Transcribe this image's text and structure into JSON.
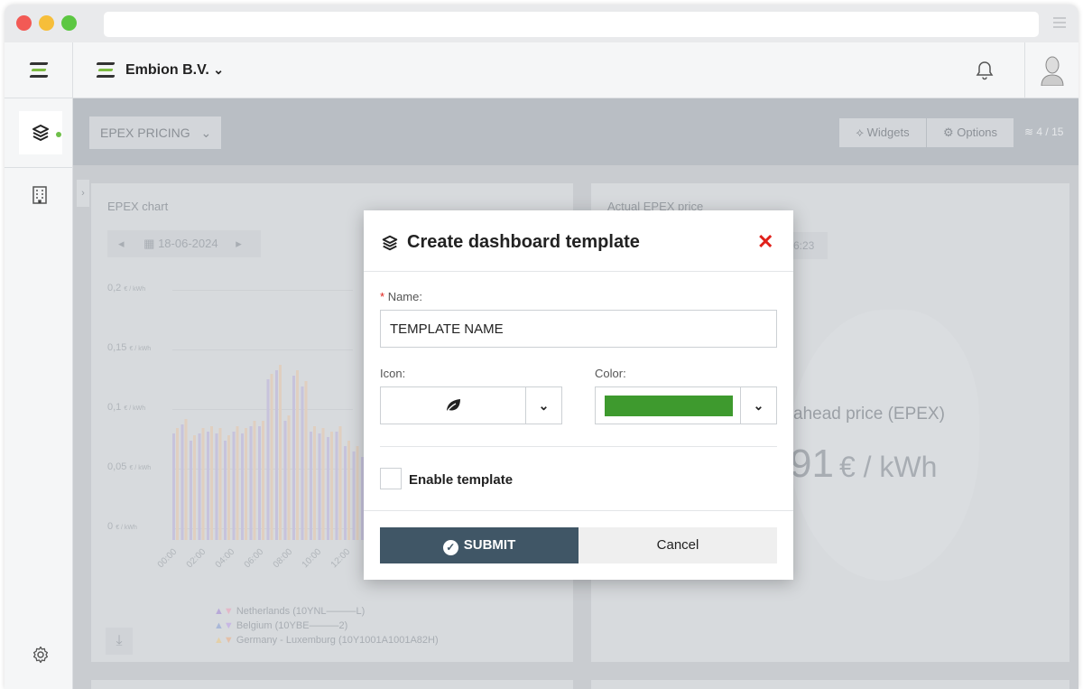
{
  "app": {
    "company": "Embion B.V.",
    "company_chevron": "⌄"
  },
  "toolbar": {
    "dashboard_select": "EPEX PRICING",
    "widgets_label": "Widgets",
    "options_label": "Options",
    "dashboard_count": "4 / 15"
  },
  "epex_chart_card": {
    "title": "EPEX chart",
    "date": "18-06-2024",
    "y_ticks": [
      "0,2",
      "0,15",
      "0,1",
      "0,05",
      "0"
    ],
    "y_unit": "€ / kWh",
    "x_ticks": [
      "00:00",
      "02:00",
      "04:00",
      "06:00",
      "08:00",
      "10:00",
      "12:00"
    ],
    "legend": [
      "Netherlands (10YNL———L)",
      "Belgium (10YBE———2)",
      "Germany - Luxemburg (10Y1001A1001A82H)"
    ]
  },
  "actual_price_card": {
    "title": "Actual EPEX price",
    "time_partial": "6:23",
    "label_partial": "ahead price (EPEX)",
    "value_partial": "91",
    "unit": "€ / kWh"
  },
  "modal": {
    "title": "Create dashboard template",
    "close_icon": "✕",
    "name_label": "Name:",
    "required_mark": "*",
    "name_value": "TEMPLATE NAME",
    "icon_label": "Icon:",
    "selected_icon": "leaf-icon",
    "color_label": "Color:",
    "selected_color": "#3e9a2e",
    "enable_label": "Enable template",
    "enable_checked": false,
    "submit_label": "SUBMIT",
    "cancel_label": "Cancel"
  },
  "colors": {
    "accent": "#405666",
    "close": "#e0201a",
    "status_dot": "#6fbf4a"
  }
}
